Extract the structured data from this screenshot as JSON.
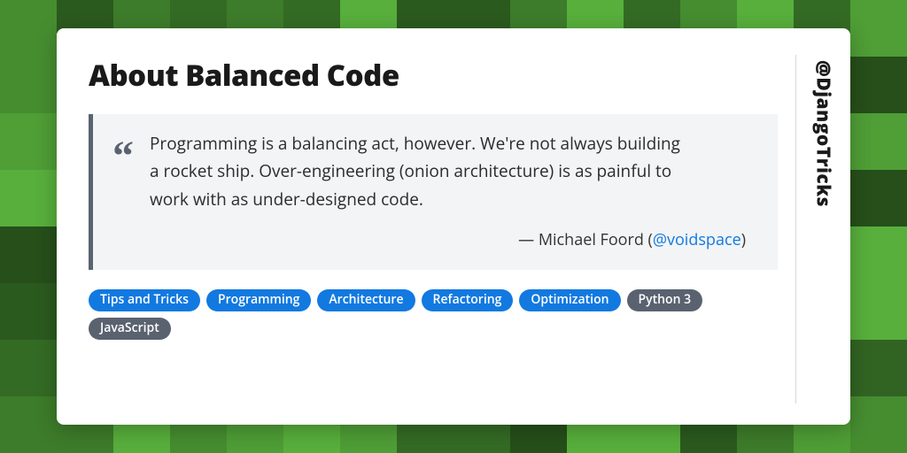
{
  "title": "About Balanced Code",
  "quote": {
    "text": "Programming is a balancing act, however. We're not always building a rocket ship. Over-engineering (onion architecture) is as painful to work with as under-designed code.",
    "author_prefix": "— Michael Foord (",
    "author_handle": "@voidspace",
    "author_suffix": ")"
  },
  "tags": [
    {
      "label": "Tips and Tricks",
      "variant": "blue"
    },
    {
      "label": "Programming",
      "variant": "blue"
    },
    {
      "label": "Architecture",
      "variant": "blue"
    },
    {
      "label": "Refactoring",
      "variant": "blue"
    },
    {
      "label": "Optimization",
      "variant": "blue"
    },
    {
      "label": "Python 3",
      "variant": "gray"
    },
    {
      "label": "JavaScript",
      "variant": "gray"
    }
  ],
  "brand_handle": "@DjangoTricks",
  "bg_palette": [
    "#2b5a1e",
    "#346b24",
    "#3d7c2a",
    "#468d30",
    "#4f9e36",
    "#58af3c",
    "#316422",
    "#264f1a"
  ]
}
